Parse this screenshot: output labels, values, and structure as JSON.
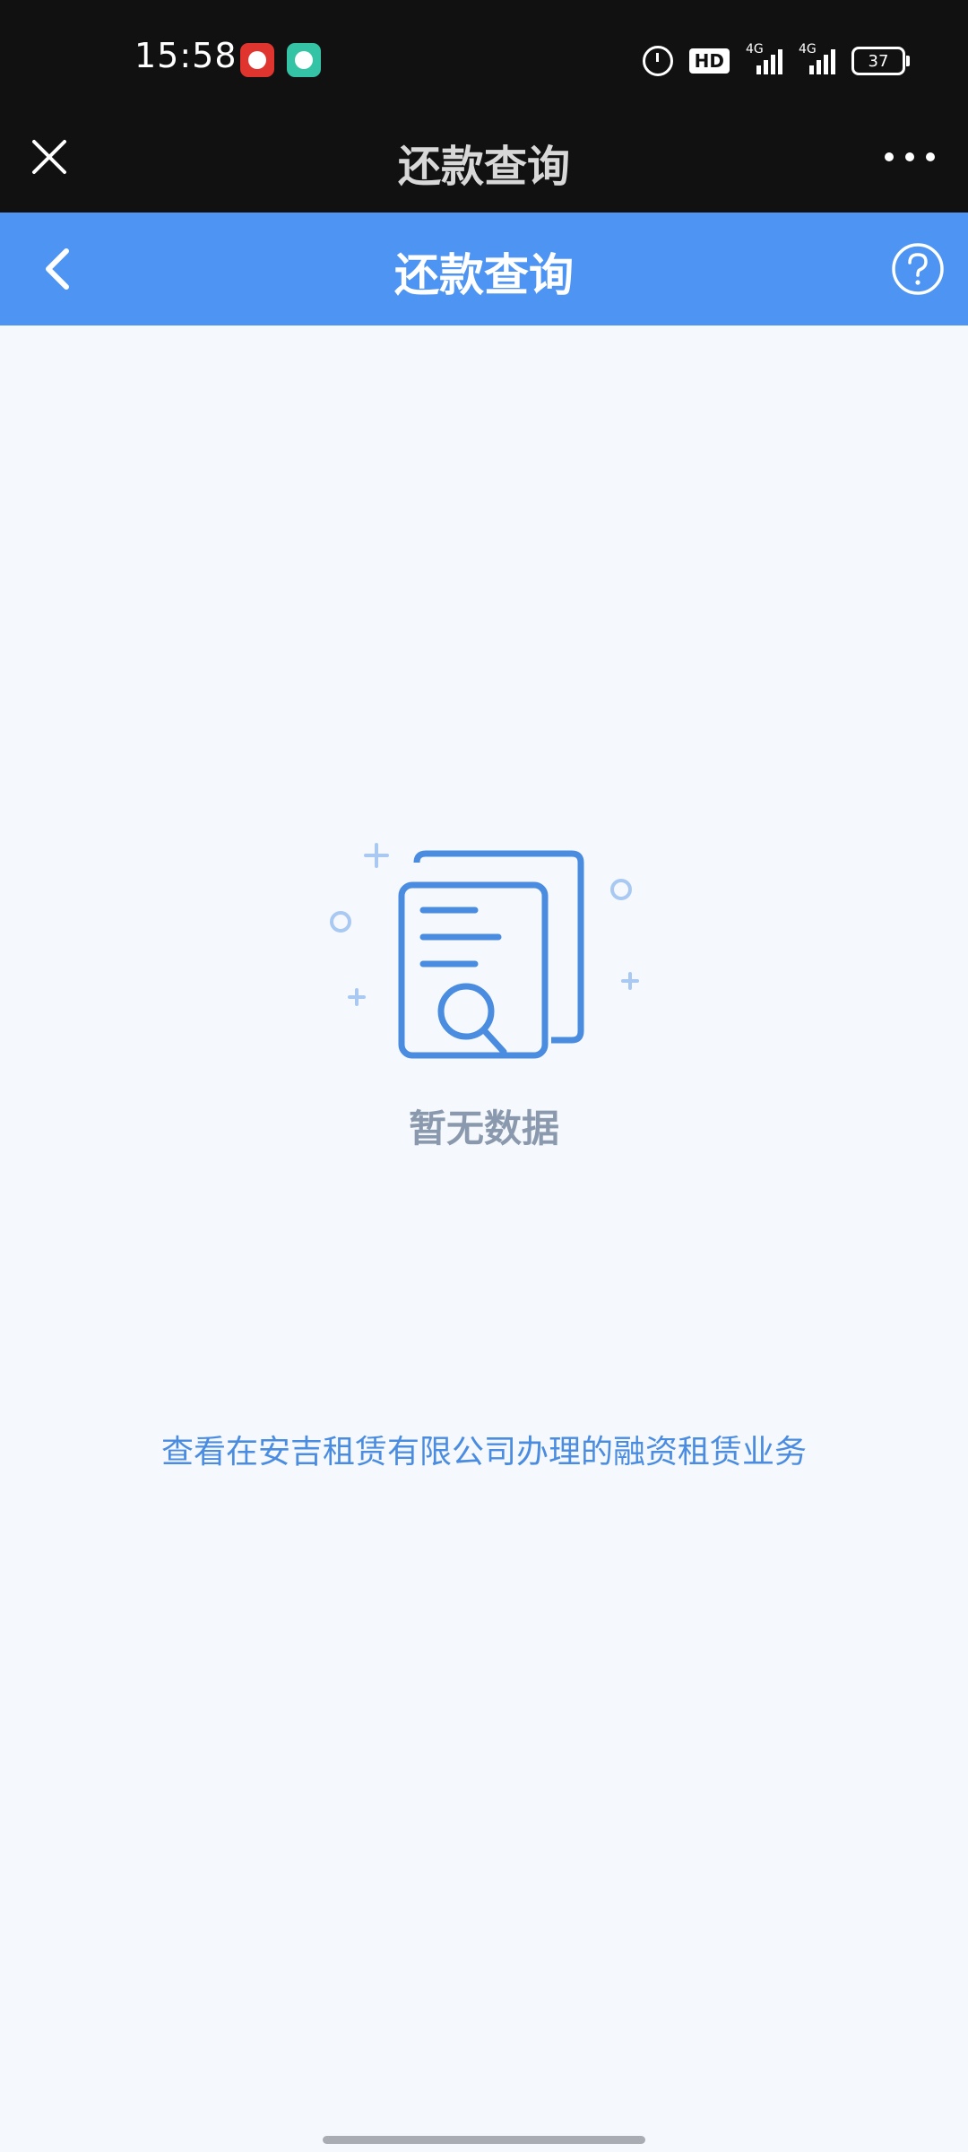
{
  "status_bar": {
    "time": "15:58",
    "hd_label": "HD",
    "network_1": "4G",
    "network_2": "4G",
    "battery": "37"
  },
  "top_nav": {
    "title": "还款查询"
  },
  "header": {
    "title": "还款查询"
  },
  "empty_state": {
    "message": "暂无数据"
  },
  "info": {
    "text": "查看在安吉租赁有限公司办理的融资租赁业务"
  },
  "colors": {
    "header_bg": "#4e95f3",
    "accent_text": "#4a8ce0",
    "status_bg": "#111111",
    "page_bg": "#f5f8fc"
  }
}
